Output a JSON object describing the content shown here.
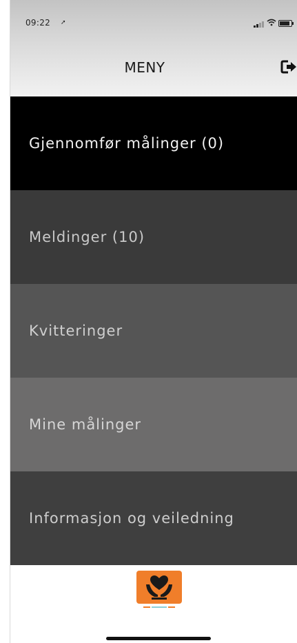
{
  "status_bar": {
    "time": "09:22"
  },
  "header": {
    "title": "MENY"
  },
  "menu": {
    "items": [
      {
        "label": "Gjennomfør målinger (0)"
      },
      {
        "label": "Meldinger (10)"
      },
      {
        "label": "Kvitteringer"
      },
      {
        "label": "Mine målinger"
      },
      {
        "label": "Informasjon og veiledning"
      }
    ]
  },
  "icons": {
    "logout": "logout-icon",
    "logo": "heart-in-hands-logo"
  },
  "colors": {
    "logo_orange": "#f07e2a",
    "menu_backgrounds": [
      "#000000",
      "#3a3a3a",
      "#555555",
      "#6d6c6c",
      "#3f3f3f"
    ]
  }
}
